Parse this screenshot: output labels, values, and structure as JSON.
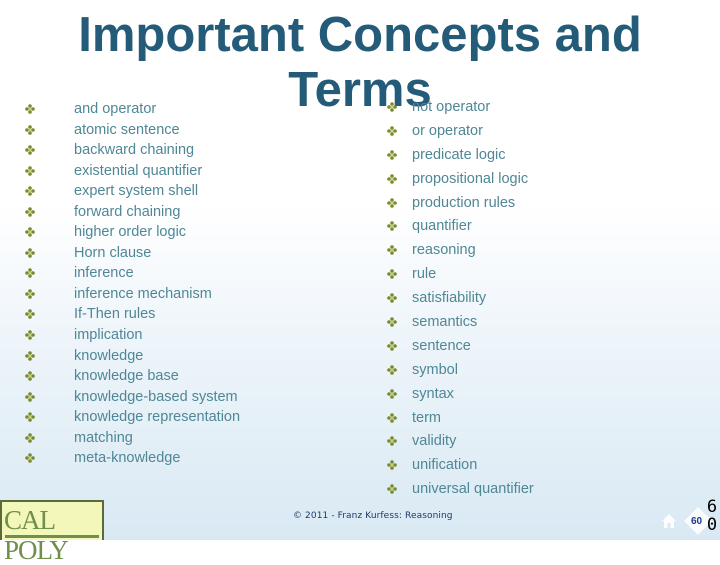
{
  "slide": {
    "title": "Important Concepts and Terms",
    "bullet_icon": "four-leaf-diamond-bullet",
    "colors": {
      "title": "#245b78",
      "item_text": "#4f8796",
      "bullet": "#7a8a2a",
      "footer_text": "#1d3a66"
    },
    "left_column": [
      "and operator",
      "atomic sentence",
      "backward chaining",
      "existential quantifier",
      "expert system shell",
      "forward chaining",
      "higher order logic",
      "Horn clause",
      "inference",
      "inference mechanism",
      "If-Then rules",
      "implication",
      "knowledge",
      "knowledge base",
      "knowledge-based system",
      "knowledge representation",
      "matching",
      "meta-knowledge"
    ],
    "right_column": [
      "not operator",
      "or operator",
      "predicate logic",
      "propositional logic",
      "production rules",
      "quantifier",
      "reasoning",
      "rule",
      "satisfiability",
      "semantics",
      "sentence",
      "symbol",
      "syntax",
      "term",
      "validity",
      "unification",
      "universal quantifier"
    ]
  },
  "footer": {
    "logo_text": "CAL POLY",
    "copyright": "© 2011 - Franz Kurfess: Reasoning",
    "page_number_badge": "60",
    "page_number_big_top": "6",
    "page_number_big_bottom": "0"
  }
}
